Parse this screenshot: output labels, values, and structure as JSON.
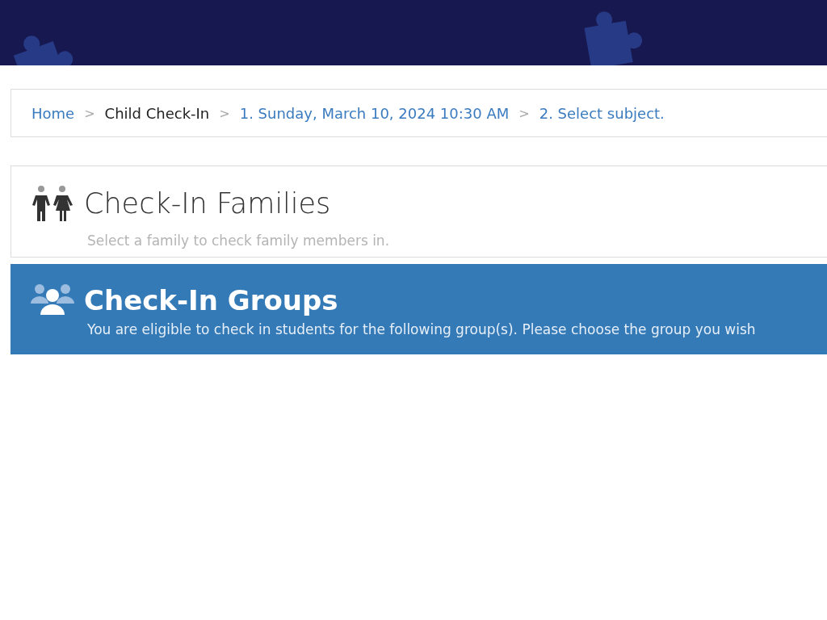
{
  "breadcrumb": [
    {
      "label": "Home",
      "link": true
    },
    {
      "label": "Child Check-In",
      "link": false
    },
    {
      "label": "1. Sunday, March 10, 2024 10:30 AM",
      "link": true
    },
    {
      "label": "2. Select subject.",
      "link": true
    }
  ],
  "separator": ">",
  "options": [
    {
      "kind": "families",
      "title": "Check-In Families",
      "description": "Select a family to check family members in.",
      "selected": false
    },
    {
      "kind": "groups",
      "title": "Check-In Groups",
      "description": "You are eligible to check in students for the following group(s). Please choose the group you wish",
      "selected": true
    }
  ]
}
